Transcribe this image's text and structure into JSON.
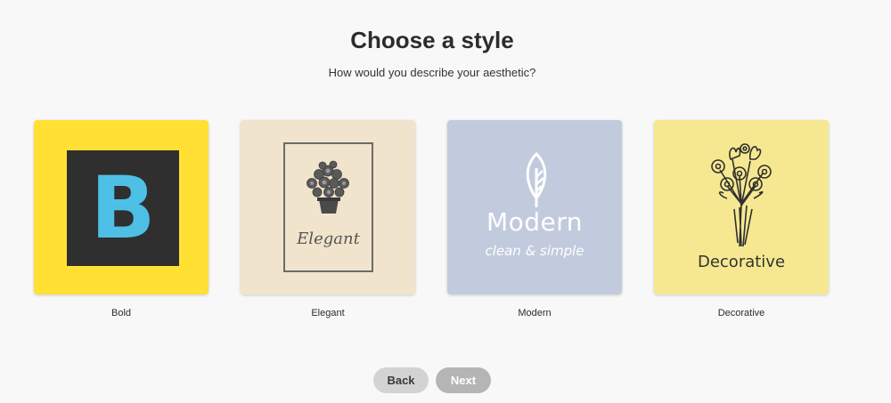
{
  "header": {
    "title": "Choose a style",
    "subtitle": "How would you describe your aesthetic?"
  },
  "styles": [
    {
      "label": "Bold",
      "tile_text": "B",
      "background": "#ffe033",
      "accent": "#4ec0e6",
      "icon": "bold-letter-logo"
    },
    {
      "label": "Elegant",
      "tile_text": "Elegant",
      "background": "#f1e4cc",
      "icon": "potted-plant-icon"
    },
    {
      "label": "Modern",
      "tile_text": "Modern",
      "tile_subtext": "clean & simple",
      "background": "#c1cbdd",
      "icon": "leaf-icon"
    },
    {
      "label": "Decorative",
      "tile_text": "Decorative",
      "background": "#f6e890",
      "icon": "flower-bouquet-icon"
    }
  ],
  "footer": {
    "back_label": "Back",
    "next_label": "Next"
  }
}
